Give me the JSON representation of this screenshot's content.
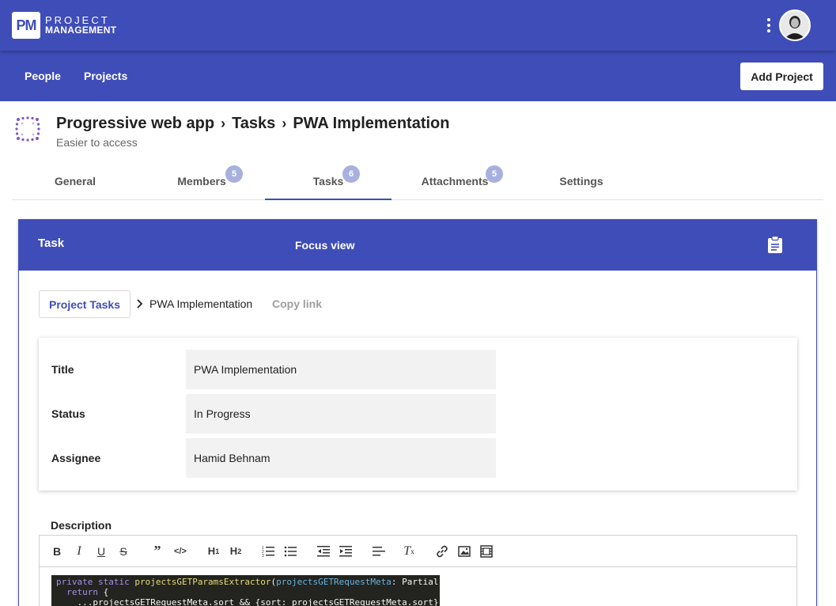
{
  "app": {
    "logo_mark": "PM",
    "logo_line1": "PROJECT",
    "logo_line2": "MANAGEMENT"
  },
  "nav": {
    "people": "People",
    "projects": "Projects",
    "add_project": "Add Project"
  },
  "project": {
    "name": "Progressive web app",
    "section": "Tasks",
    "task": "PWA Implementation",
    "subtitle": "Easier to access"
  },
  "tabs": [
    {
      "label": "General",
      "badge": null
    },
    {
      "label": "Members",
      "badge": "5"
    },
    {
      "label": "Tasks",
      "badge": "6",
      "active": true
    },
    {
      "label": "Attachments",
      "badge": "5"
    },
    {
      "label": "Settings",
      "badge": null
    }
  ],
  "card": {
    "header_title": "Task",
    "focus_view": "Focus view",
    "project_tasks_button": "Project Tasks",
    "crumb_current": "PWA Implementation",
    "copy_link": "Copy link"
  },
  "fields": {
    "title_label": "Title",
    "title_value": "PWA Implementation",
    "status_label": "Status",
    "status_value": "In Progress",
    "assignee_label": "Assignee",
    "assignee_value": "Hamid Behnam"
  },
  "description": {
    "label": "Description",
    "code": {
      "line1_kw": "private static ",
      "line1_fn": "projectsGETParamsExtractor",
      "line1_p1": "(",
      "line1_param": "projectsGETRequestMeta",
      "line1_rest": ": Partial",
      "line2_kw": "  return",
      "line2_rest": " {",
      "line3": "    ...projectsGETRequestMeta.sort && {sort: projectsGETRequestMeta.sort}"
    }
  },
  "toolbar_icons": [
    "bold-icon",
    "italic-icon",
    "underline-icon",
    "strikethrough-icon",
    "blockquote-icon",
    "code-icon",
    "heading1-icon",
    "heading2-icon",
    "ordered-list-icon",
    "bullet-list-icon",
    "outdent-icon",
    "indent-icon",
    "align-icon",
    "clear-format-icon",
    "link-icon",
    "image-icon",
    "video-icon"
  ],
  "colors": {
    "primary": "#3f4db8",
    "badge": "#a8b0de",
    "field_bg": "#f2f2f2"
  }
}
